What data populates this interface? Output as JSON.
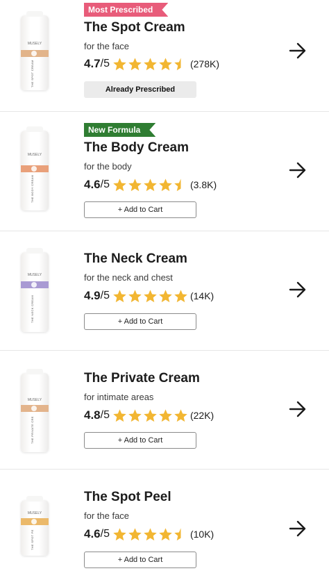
{
  "products": [
    {
      "badge": "Most Prescribed",
      "badge_color": "#e85c7a",
      "title": "The Spot Cream",
      "subtitle": "for the face",
      "score": "4.7",
      "score_out_of": "/5",
      "stars": 4.5,
      "review_count": "(278K)",
      "button_label": "Already Prescribed",
      "button_style": "muted",
      "thumb_band_color": "#e2b48a",
      "thumb_brand": "MUSELY",
      "thumb_label": "THE SPOT CREAM"
    },
    {
      "badge": "New Formula",
      "badge_color": "#2f7d32",
      "title": "The Body Cream",
      "subtitle": "for the body",
      "score": "4.6",
      "score_out_of": "/5",
      "stars": 4.5,
      "review_count": "(3.8K)",
      "button_label": "+ Add to Cart",
      "button_style": "outline",
      "thumb_band_color": "#e9a07a",
      "thumb_brand": "MUSELY",
      "thumb_label": "THE BODY CREAM"
    },
    {
      "badge": "",
      "title": "The Neck Cream",
      "subtitle": "for the neck and chest",
      "score": "4.9",
      "score_out_of": "/5",
      "stars": 5,
      "review_count": "(14K)",
      "button_label": "+ Add to Cart",
      "button_style": "outline",
      "thumb_band_color": "#a99ad3",
      "thumb_brand": "MUSELY",
      "thumb_label": "THE NECK CREAM"
    },
    {
      "badge": "",
      "title": "The Private Cream",
      "subtitle": "for intimate areas",
      "score": "4.8",
      "score_out_of": "/5",
      "stars": 5,
      "review_count": "(22K)",
      "button_label": "+ Add to Cart",
      "button_style": "outline",
      "thumb_band_color": "#e3b48c",
      "thumb_brand": "MUSELY",
      "thumb_label": "THE PRIVATE CREAM"
    },
    {
      "badge": "",
      "title": "The Spot Peel",
      "subtitle": "for the face",
      "score": "4.6",
      "score_out_of": "/5",
      "stars": 4.5,
      "review_count": "(10K)",
      "button_label": "+ Add to Cart",
      "button_style": "outline",
      "thumb_band_color": "#ebb96a",
      "thumb_brand": "MUSELY",
      "thumb_label": "THE SPOT PEEL"
    }
  ],
  "icons": {
    "next": "arrow-right-icon",
    "rating": "star-icon"
  },
  "colors": {
    "star": "#f2b632",
    "text": "#1c1c1c"
  }
}
